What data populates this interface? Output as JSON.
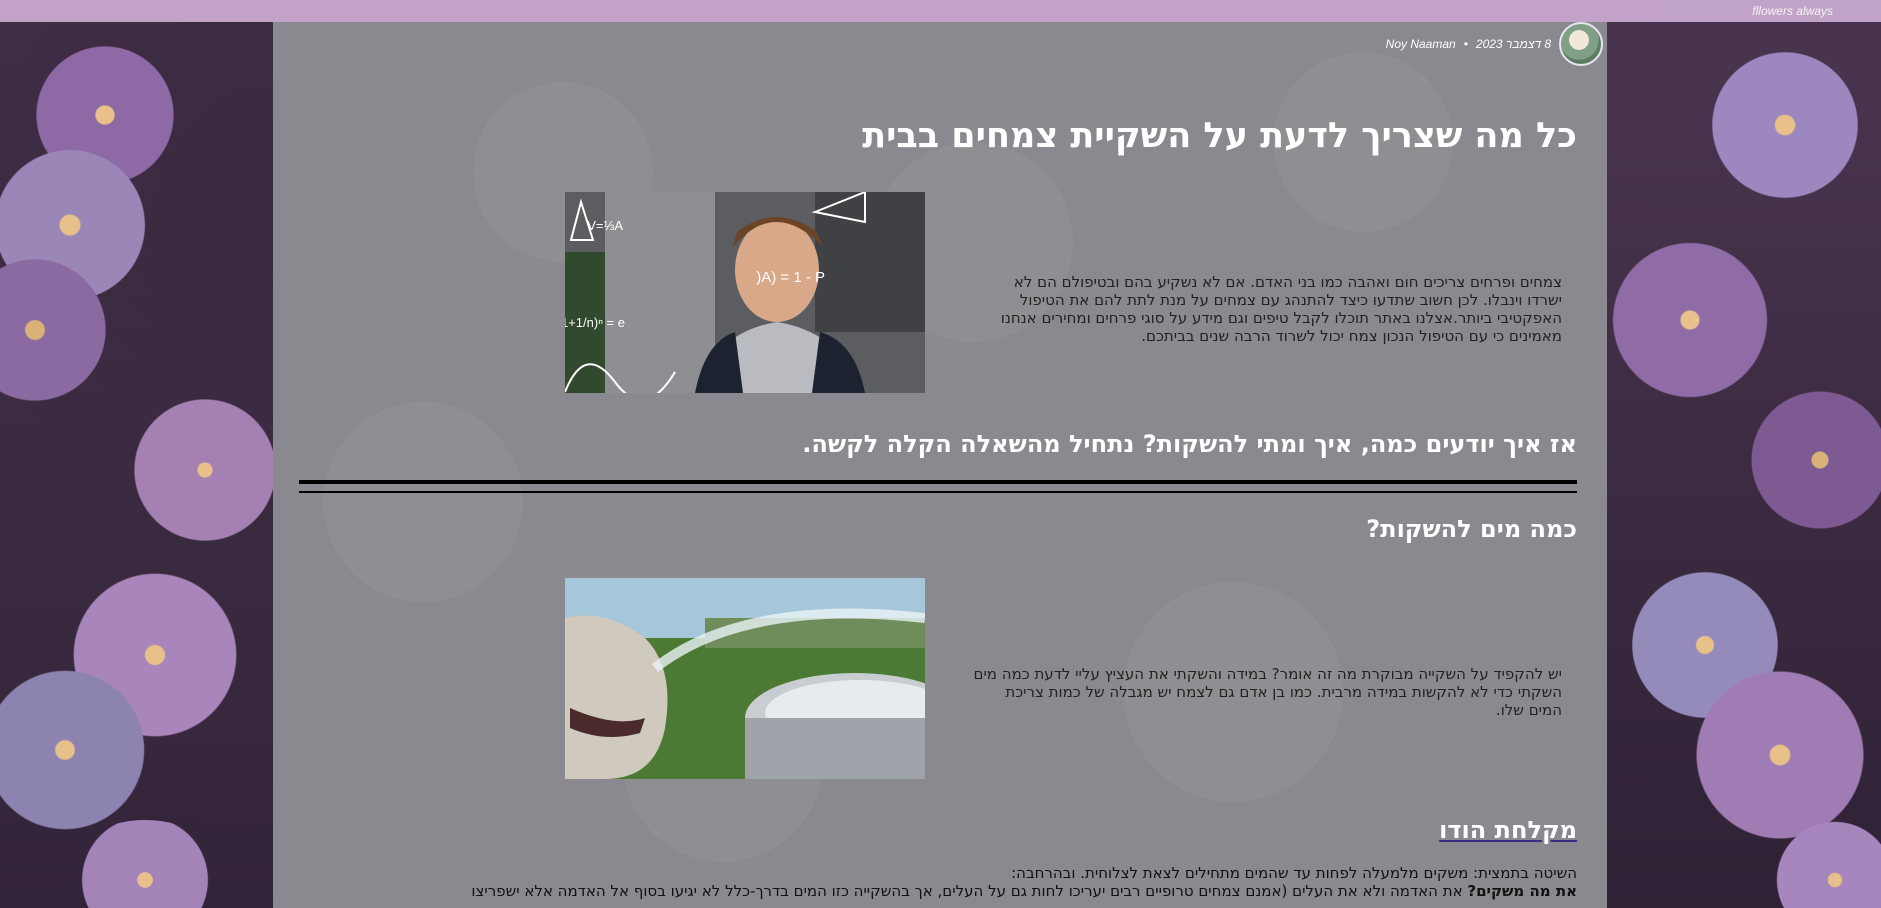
{
  "site": {
    "brand": "fllowers always"
  },
  "post": {
    "author": "Noy Naaman",
    "date": "8 דצמבר 2023",
    "meta_sep": "•",
    "title": "כל מה שצריך לדעת על השקיית צמחים בבית",
    "intro": "צמחים ופרחים צריכים חום ואהבה כמו בני האדם. אם לא נשקיע בהם ובטיפולם הם לא ישרדו וינבלו. לכן חשוב שתדעו כיצד להתנהג עם צמחים על מנת לתת להם את הטיפול האפקטיבי ביותר.אצלנו באתר תוכלו לקבל טיפים וגם מידע על סוגי פרחים ומחירים אנחנו מאמינים כי עם הטיפול הנכון צמח יכול לשרוד הרבה שנים בביתכם.",
    "question1": "אז איך יודעים כמה, איך ומתי להשקות? נתחיל מהשאלה הקלה לקשה.",
    "question2": "כמה מים להשקות?",
    "para2": "יש להקפיד על השקייה מבוקרת מה זה אומר? במידה והשקתי את העציץ עליי לדעת כמה מים השקתי כדי לא להקשות במידה מרבית. כמו בן אדם גם לצמח יש מגבלה של כמות צריכת המים שלו.",
    "question3": "מקלחת הודו",
    "para3_line1": "השיטה בתמצית: משקים מלמעלה לפחות עד שהמים מתחילים לצאת לצלוחית. ובהרחבה:",
    "para3_bold": "את מה משקים?",
    "para3_line2": " את האדמה ולא את העלים (אמנם צמחים טרופיים רבים יעריכו לחות גם על העלים, אך בהשקייה כזו המים בדרך-כלל לא יגיעו בסוף אל האדמה אלא ישפריצו"
  },
  "colors": {
    "topbar": "#c9a9cf",
    "content_bg": "#8a898f",
    "heading": "#ffffff",
    "body_text": "#222222",
    "rule": "#000000"
  }
}
